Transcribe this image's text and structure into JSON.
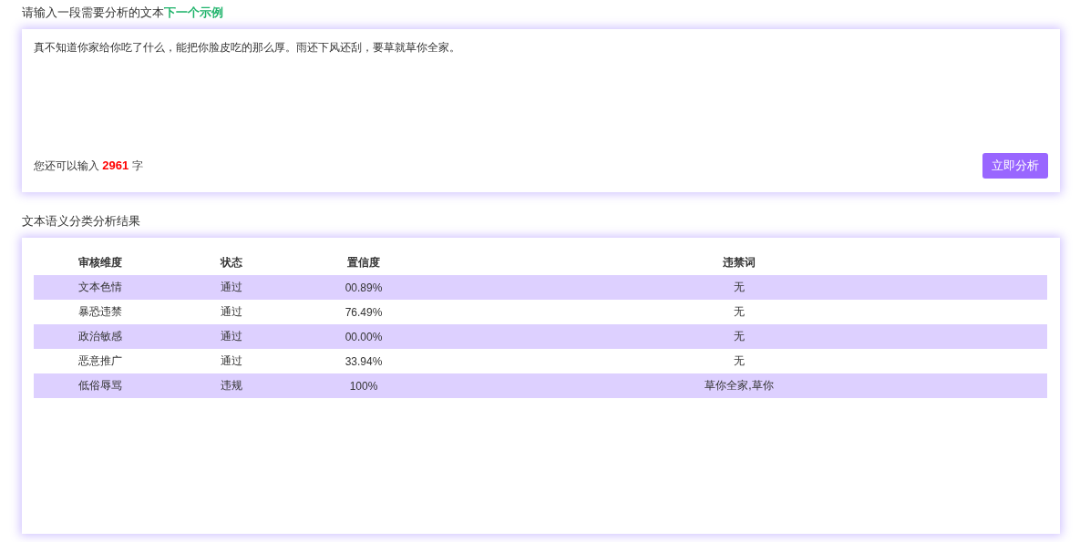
{
  "input_section": {
    "title": "请输入一段需要分析的文本",
    "next_example_link": "下一个示例",
    "value": "真不知道你家给你吃了什么，能把你脸皮吃的那么厚。雨还下风还刮，要草就草你全家。",
    "remaining_prefix": "您还可以输入",
    "remaining_count": "2961",
    "remaining_suffix": "字",
    "analyze_button": "立即分析"
  },
  "result_section": {
    "title": "文本语义分类分析结果",
    "table": {
      "columns": [
        "审核维度",
        "状态",
        "置信度",
        "违禁词"
      ],
      "rows": [
        [
          "文本色情",
          "通过",
          "00.89%",
          "无"
        ],
        [
          "暴恐违禁",
          "通过",
          "76.49%",
          "无"
        ],
        [
          "政治敏感",
          "通过",
          "00.00%",
          "无"
        ],
        [
          "恶意推广",
          "通过",
          "33.94%",
          "无"
        ],
        [
          "低俗辱骂",
          "违规",
          "100%",
          "草你全家,草你"
        ]
      ]
    }
  }
}
